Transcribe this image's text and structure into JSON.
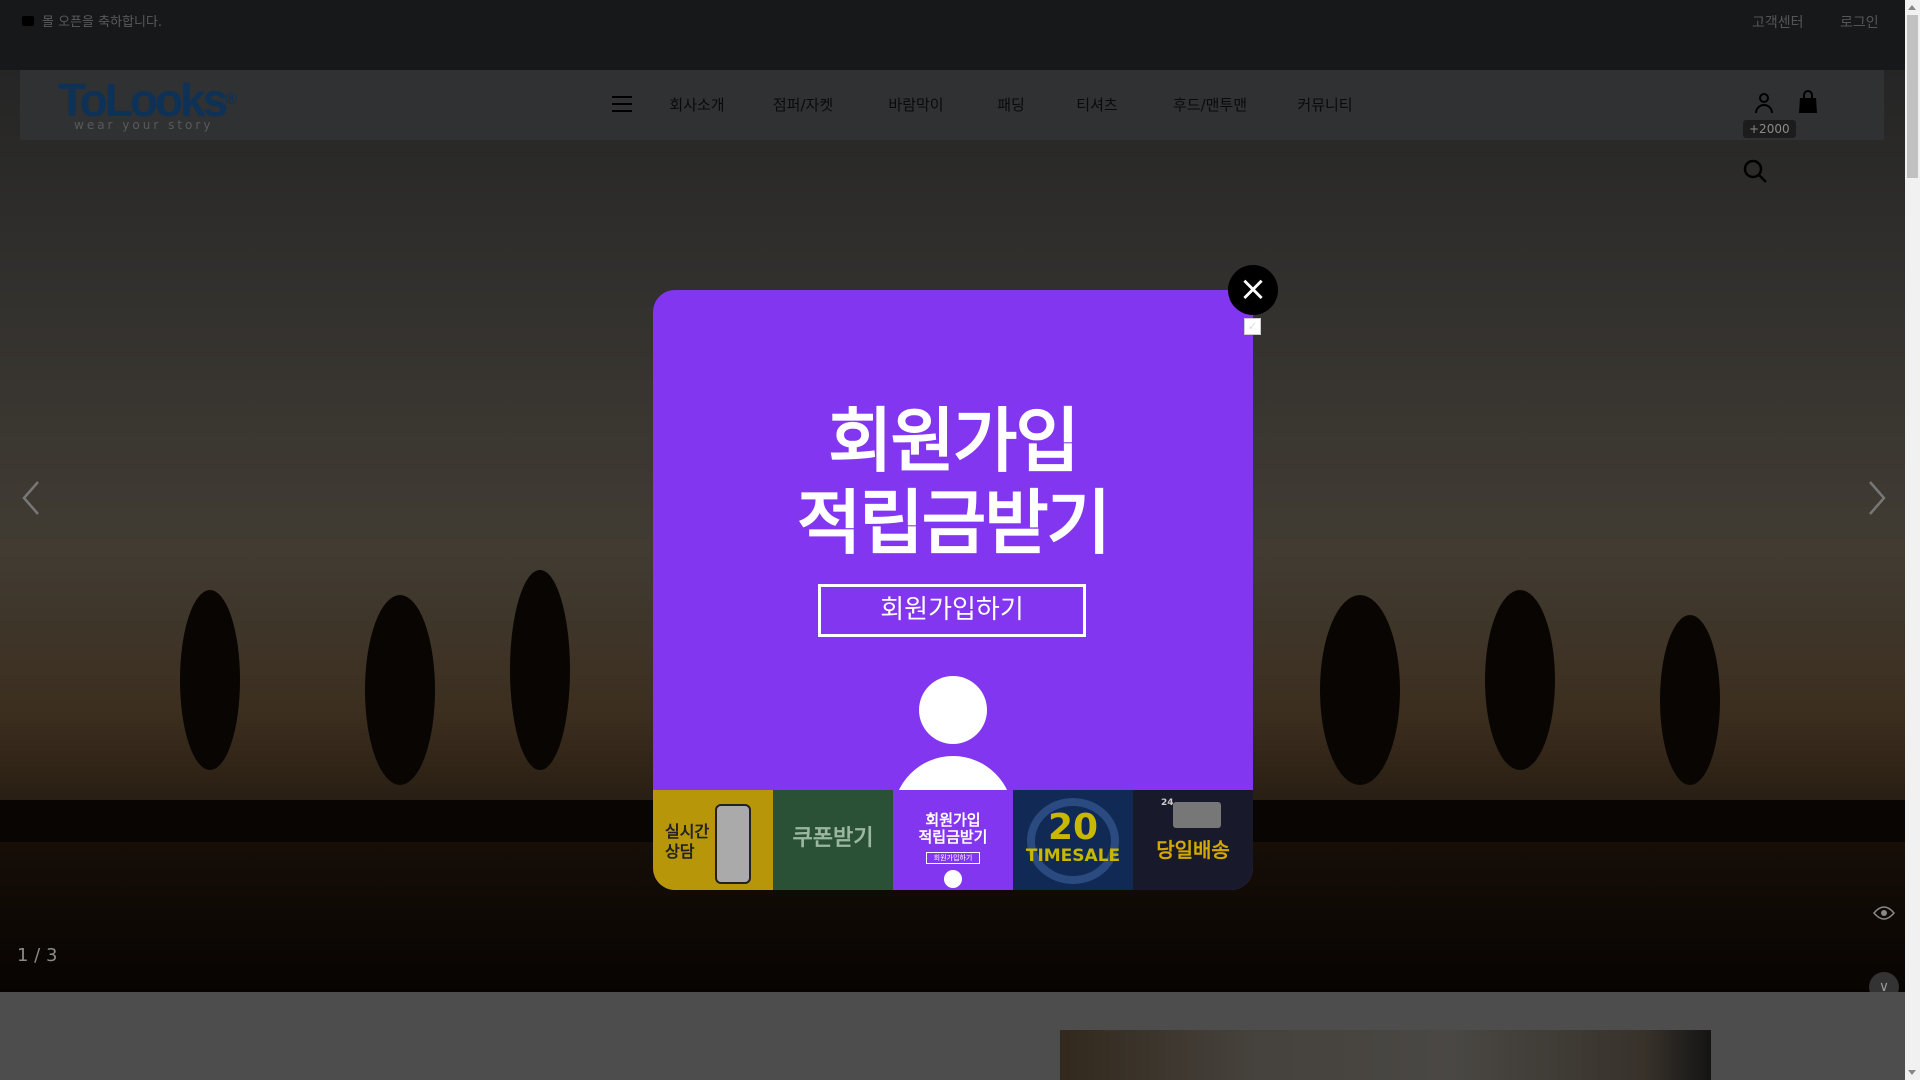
{
  "topbar": {
    "notice": "몰 오픈을 축하합니다.",
    "customer_center": "고객센터",
    "login": "로그인"
  },
  "header": {
    "logo_name": "ToLooks",
    "logo_reg": "®",
    "logo_tagline": "wear your story",
    "nav": [
      "회사소개",
      "점퍼/자켓",
      "바람막이",
      "패딩",
      "티셔츠",
      "후드/맨투맨",
      "커뮤니티"
    ],
    "points_badge": "+2000"
  },
  "hero": {
    "counter": "1 / 3"
  },
  "popup": {
    "title_line1": "회원가입",
    "title_line2": "적립금받기",
    "button": "회원가입하기",
    "thumbs": [
      {
        "line1": "실시간",
        "line2": "상담"
      },
      {
        "label": "쿠폰받기"
      },
      {
        "line1": "회원가입",
        "line2": "적립금받기",
        "button": "회원가입하기"
      },
      {
        "number": "20",
        "label": "TIMESALE"
      },
      {
        "badge": "24",
        "label": "당일배송"
      }
    ],
    "accent": "#8236ef"
  }
}
